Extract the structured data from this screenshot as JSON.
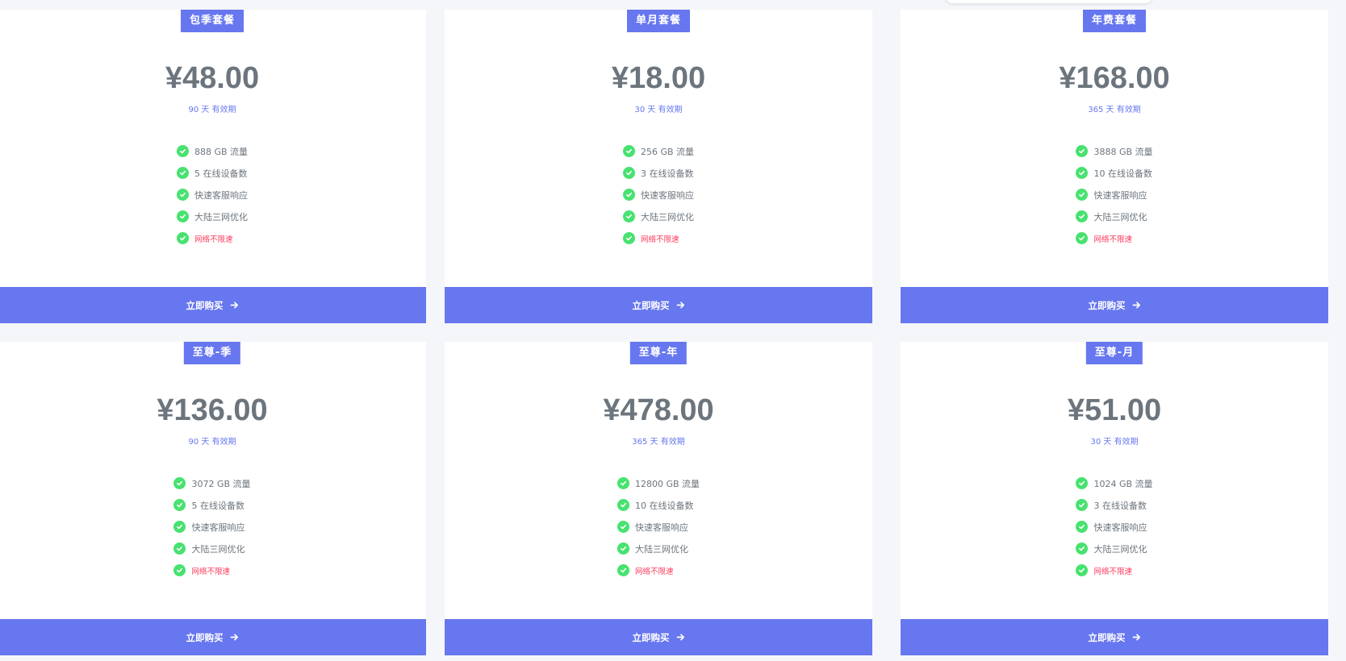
{
  "plans": [
    {
      "name": "包季套餐",
      "price": "¥48.00",
      "validity": "90 天 有效期",
      "features": [
        "888 GB 流量",
        "5 在线设备数",
        "快速客服响应",
        "大陆三网优化"
      ],
      "highlight": "网络不限速",
      "button": "立即购买"
    },
    {
      "name": "单月套餐",
      "price": "¥18.00",
      "validity": "30 天 有效期",
      "features": [
        "256 GB 流量",
        "3 在线设备数",
        "快速客服响应",
        "大陆三网优化"
      ],
      "highlight": "网络不限速",
      "button": "立即购买"
    },
    {
      "name": "年费套餐",
      "price": "¥168.00",
      "validity": "365 天 有效期",
      "features": [
        "3888 GB 流量",
        "10 在线设备数",
        "快速客服响应",
        "大陆三网优化"
      ],
      "highlight": "网络不限速",
      "button": "立即购买"
    },
    {
      "name": "至尊-季",
      "price": "¥136.00",
      "validity": "90 天 有效期",
      "features": [
        "3072 GB 流量",
        "5 在线设备数",
        "快速客服响应",
        "大陆三网优化"
      ],
      "highlight": "网络不限速",
      "button": "立即购买"
    },
    {
      "name": "至尊-年",
      "price": "¥478.00",
      "validity": "365 天 有效期",
      "features": [
        "12800 GB 流量",
        "10 在线设备数",
        "快速客服响应",
        "大陆三网优化"
      ],
      "highlight": "网络不限速",
      "button": "立即购买"
    },
    {
      "name": "至尊-月",
      "price": "¥51.00",
      "validity": "30 天 有效期",
      "features": [
        "1024 GB 流量",
        "3 在线设备数",
        "快速客服响应",
        "大陆三网优化"
      ],
      "highlight": "网络不限速",
      "button": "立即购买"
    }
  ],
  "colors": {
    "accent": "#6777ef",
    "check": "#47e26f",
    "price_text": "#6c757d",
    "highlight": "#fc3c5e"
  },
  "icons": {
    "feature": "check-circle-icon",
    "button": "arrow-right-icon"
  }
}
